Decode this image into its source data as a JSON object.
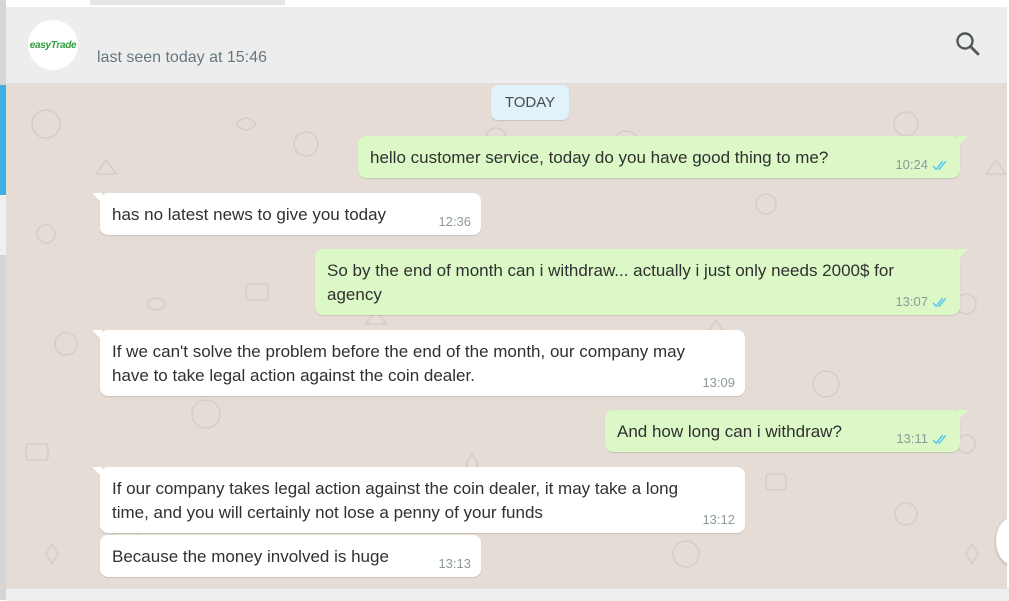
{
  "header": {
    "avatar_text": "easyTrade",
    "last_seen": "last seen today at 15:46",
    "search_icon": "search-icon"
  },
  "chat": {
    "date_separator": "TODAY",
    "messages": [
      {
        "direction": "out",
        "text": "hello customer service, today do you have good thing to me?",
        "time": "10:24",
        "status": "read"
      },
      {
        "direction": "in",
        "text": "has no latest news to give you today",
        "time": "12:36"
      },
      {
        "direction": "out",
        "line1": "So by the end of month can i withdraw... actually i just only needs 2000$ for",
        "line2": "agency",
        "time": "13:07",
        "status": "read"
      },
      {
        "direction": "in",
        "line1": "If we can't solve the problem before the end of the month, our company may",
        "line2": "have to take legal action against the coin dealer.",
        "time": "13:09"
      },
      {
        "direction": "out",
        "text": "And how long can i withdraw?",
        "time": "13:11",
        "status": "read"
      },
      {
        "direction": "in",
        "line1": "If our company takes legal action against the coin dealer, it may take a long",
        "line2": "time, and you will certainly not lose a penny of your funds",
        "time": "13:12"
      },
      {
        "direction": "in",
        "text": "Because the money involved is huge",
        "time": "13:13"
      }
    ]
  },
  "colors": {
    "outgoing": "#dcf8c6",
    "incoming": "#ffffff",
    "wallpaper": "#e5ddd5",
    "read_tick": "#4fc3f7"
  }
}
